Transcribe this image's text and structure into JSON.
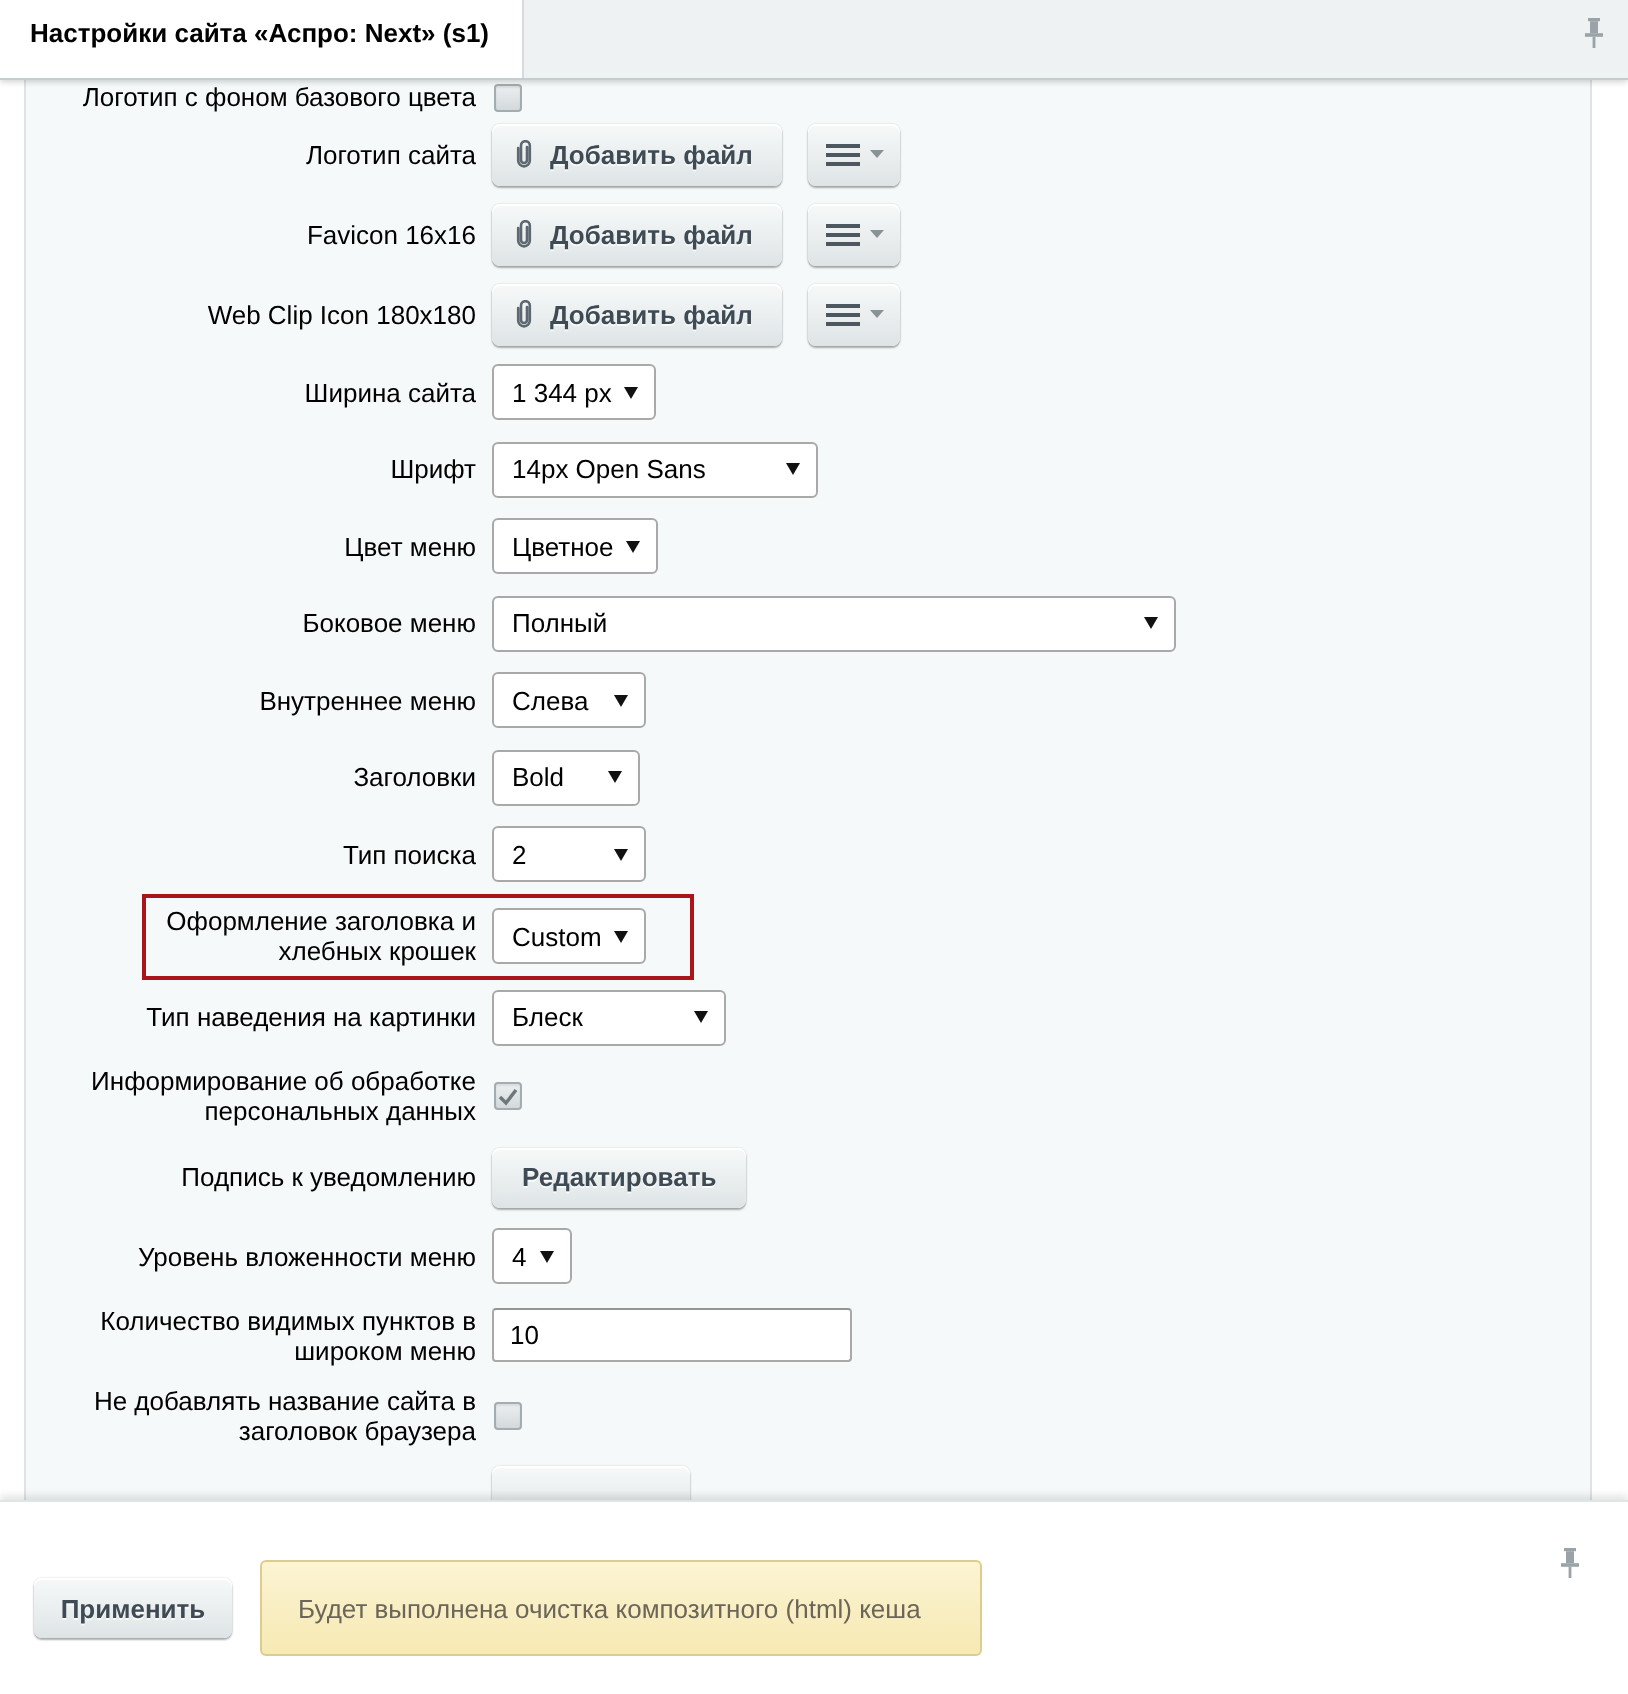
{
  "window": {
    "title": "Настройки сайта «Аспро: Next» (s1)"
  },
  "settings": [
    {
      "kind": "checkbox",
      "label": "Логотип с фоном базового цвета",
      "checked": false,
      "highlighted": false
    },
    {
      "kind": "file",
      "label": "Логотип сайта",
      "button": "Добавить файл",
      "highlighted": false
    },
    {
      "kind": "file",
      "label": "Favicon 16x16",
      "button": "Добавить файл",
      "highlighted": false
    },
    {
      "kind": "file",
      "label": "Web Clip Icon 180x180",
      "button": "Добавить файл",
      "highlighted": false
    },
    {
      "kind": "select",
      "label": "Ширина сайта",
      "value": "1 344 px",
      "highlighted": false
    },
    {
      "kind": "select",
      "label": "Шрифт",
      "value": "14px Open Sans",
      "highlighted": false
    },
    {
      "kind": "select",
      "label": "Цвет меню",
      "value": "Цветное",
      "highlighted": false
    },
    {
      "kind": "select",
      "label": "Боковое меню",
      "value": "Полный",
      "highlighted": false
    },
    {
      "kind": "select",
      "label": "Внутреннее меню",
      "value": "Слева",
      "highlighted": false
    },
    {
      "kind": "select",
      "label": "Заголовки",
      "value": "Bold",
      "highlighted": false
    },
    {
      "kind": "select",
      "label": "Тип поиска",
      "value": "2",
      "highlighted": false
    },
    {
      "kind": "select",
      "label": "Оформление заголовка и хлебных крошек",
      "value": "Custom",
      "highlighted": true
    },
    {
      "kind": "select",
      "label": "Тип наведения на картинки",
      "value": "Блеск",
      "highlighted": false
    },
    {
      "kind": "checkbox",
      "label": "Информирование об обработке персональных данных",
      "checked": true,
      "highlighted": false
    },
    {
      "kind": "button",
      "label": "Подпись к уведомлению",
      "button": "Редактировать",
      "highlighted": false
    },
    {
      "kind": "select",
      "label": "Уровень вложенности меню",
      "value": "4",
      "highlighted": false
    },
    {
      "kind": "text",
      "label": "Количество видимых пунктов в широком меню",
      "value": "10",
      "highlighted": false
    },
    {
      "kind": "checkbox",
      "label": "Не добавлять название сайта в заголовок браузера",
      "checked": false,
      "highlighted": false
    },
    {
      "kind": "button",
      "highlighted": false
    }
  ],
  "footer": {
    "apply_button": "Применить",
    "notice": "Будет выполнена очистка композитного (html) кеша"
  }
}
